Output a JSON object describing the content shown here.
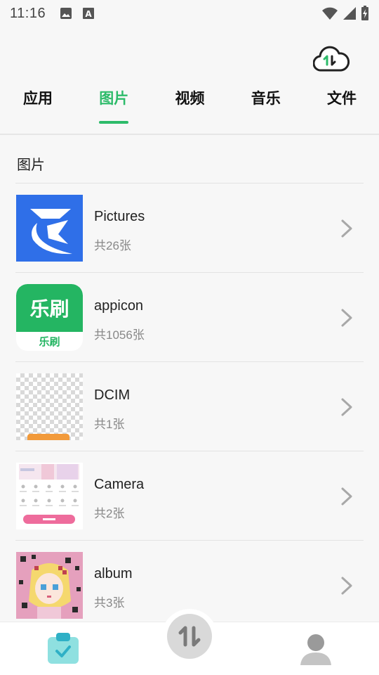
{
  "status_bar": {
    "time": "11:16",
    "icons": [
      "gallery-icon",
      "text-a-icon",
      "wifi-icon",
      "signal-icon",
      "battery-icon"
    ]
  },
  "header": {
    "cloud_icon": "cloud-transfer-icon"
  },
  "tabs": [
    {
      "label": "应用",
      "active": false
    },
    {
      "label": "图片",
      "active": true
    },
    {
      "label": "视频",
      "active": false
    },
    {
      "label": "音乐",
      "active": false
    },
    {
      "label": "文件",
      "active": false
    }
  ],
  "section": {
    "title": "图片"
  },
  "albums": [
    {
      "name": "Pictures",
      "count": "共26张",
      "thumb": "app-logo-blue"
    },
    {
      "name": "appicon",
      "count": "共1056张",
      "thumb": "lehua-green"
    },
    {
      "name": "DCIM",
      "count": "共1张",
      "thumb": "transparent-checker"
    },
    {
      "name": "Camera",
      "count": "共2张",
      "thumb": "screenshot-pink"
    },
    {
      "name": "album",
      "count": "共3张",
      "thumb": "pixel-art"
    }
  ],
  "thumb_texts": {
    "lehua_top": "乐刷",
    "lehua_bottom": "乐刷"
  },
  "bottom_nav": {
    "left": "clipboard-check-icon",
    "center": "transfer-arrows-icon",
    "right": "user-icon"
  },
  "colors": {
    "accent": "#2dbb6a",
    "chevron": "#a8a8a8"
  }
}
